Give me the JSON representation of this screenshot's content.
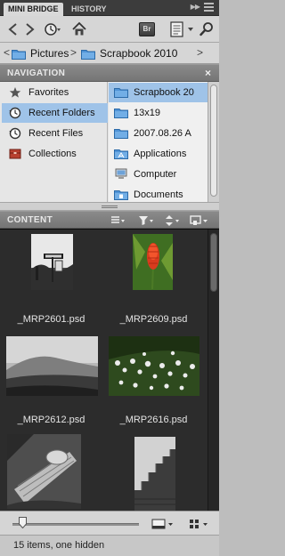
{
  "tabs": [
    {
      "label": "MINI BRIDGE",
      "active": true
    },
    {
      "label": "HISTORY",
      "active": false
    }
  ],
  "toolbar": {
    "bridge_button_label": "Br",
    "icons": [
      "back-arrow-icon",
      "forward-arrow-icon",
      "recent-items-icon",
      "home-icon",
      "bridge-icon",
      "document-icon",
      "search-icon"
    ]
  },
  "path": [
    {
      "label": "Pictures",
      "icon": "folder-icon"
    },
    {
      "label": "Scrapbook 2010",
      "icon": "folder-icon"
    }
  ],
  "navigation": {
    "title": "NAVIGATION",
    "close_glyph": "×",
    "sources": [
      {
        "label": "Favorites",
        "icon": "star-icon",
        "selected": false
      },
      {
        "label": "Recent Folders",
        "icon": "recent-folders-icon",
        "selected": true
      },
      {
        "label": "Recent Files",
        "icon": "recent-files-icon",
        "selected": false
      },
      {
        "label": "Collections",
        "icon": "collections-icon",
        "selected": false
      }
    ],
    "folders": [
      {
        "label": "Scrapbook 20",
        "icon": "folder-icon",
        "selected": true
      },
      {
        "label": "13x19",
        "icon": "folder-icon",
        "selected": false
      },
      {
        "label": "2007.08.26 A",
        "icon": "folder-icon",
        "selected": false
      },
      {
        "label": "Applications",
        "icon": "applications-folder-icon",
        "selected": false
      },
      {
        "label": "Computer",
        "icon": "computer-icon",
        "selected": false
      },
      {
        "label": "Documents",
        "icon": "documents-folder-icon",
        "selected": false
      }
    ]
  },
  "content": {
    "title": "CONTENT",
    "header_icons": [
      "view-options-icon",
      "filter-icon",
      "sort-icon",
      "tools-icon"
    ],
    "items": [
      {
        "name": "_MRP2601.psd",
        "picture": "signpost-photo"
      },
      {
        "name": "_MRP2609.psd",
        "picture": "red-flower-photo"
      },
      {
        "name": "_MRP2612.psd",
        "picture": "misty-hill-photo"
      },
      {
        "name": "_MRP2616.psd",
        "picture": "white-flowers-photo"
      },
      {
        "name": "",
        "picture": "tree-stump-photo"
      },
      {
        "name": "",
        "picture": "stone-steps-photo"
      }
    ]
  },
  "bottombar": {
    "thumbnail_size_fraction": 0.08,
    "view_icons": [
      "preview-icon",
      "view-mode-icon"
    ]
  },
  "status": {
    "text": "15 items, one hidden"
  },
  "colors": {
    "selection": "#9fc3e8",
    "folder_blue": "#4f93d6",
    "content_background": "#2c2c2c",
    "panel_header": "#7f7f7f"
  }
}
